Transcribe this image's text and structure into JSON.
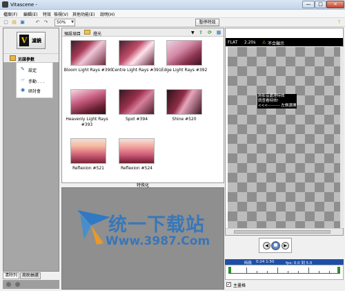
{
  "window": {
    "title": "Vitascene -",
    "min": "—",
    "max": "□",
    "close": "×"
  },
  "menu": [
    "檔案(F)",
    "編輯(E)",
    "特效",
    "檢視(V)",
    "其他功能(E)",
    "說明(H)"
  ],
  "toolbar": {
    "zoom": "50%",
    "pause_label": "暫停特效"
  },
  "left": {
    "logo_label": "濾鏡",
    "section_title": "另謀參數",
    "items": [
      {
        "label": "設定",
        "icon": "pencil-icon"
      },
      {
        "label": "手動 . . .",
        "icon": "pointer-icon"
      },
      {
        "label": "研討會",
        "icon": "globe-icon"
      }
    ],
    "tabs": [
      "清除列",
      "商助抽選"
    ]
  },
  "presets": {
    "header_label": "預設項目",
    "folder": "燈光",
    "items": [
      {
        "label": "Bloom Light Rays #390"
      },
      {
        "label": "Centre Light Rays #391"
      },
      {
        "label": "Edge Light Rays #392"
      },
      {
        "label": "Heavenly Light Rays #393"
      },
      {
        "label": "Spot #394"
      },
      {
        "label": "Shine #520"
      },
      {
        "label": "Reflexion #521"
      },
      {
        "label": "Reflexion #524"
      }
    ]
  },
  "fx_label": "特殊化",
  "right": {
    "mode": "FLAT",
    "duration": "2.20s",
    "status": "不合顯示",
    "subtitle_lines": [
      "將影音處理特效",
      "請查看特效!",
      "<<<--------- 左側選擇"
    ]
  },
  "timeline": {
    "text1": "時段",
    "text2": "0:24 1:50",
    "text3": "fps: 0.0 到 5.0",
    "show_checkbox": "主畫格"
  },
  "watermark": {
    "line1": "统一下载站",
    "line2": "Www.3987.Com"
  }
}
